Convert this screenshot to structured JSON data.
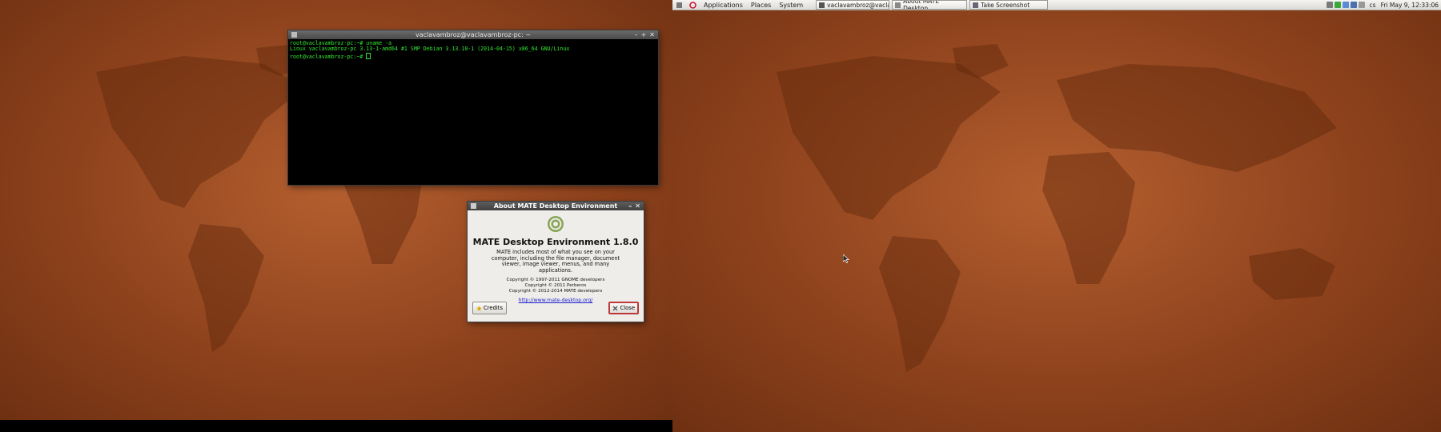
{
  "panel": {
    "menus": [
      "Applications",
      "Places",
      "System"
    ],
    "tasks": [
      {
        "label": "vaclavambroz@vaclav..."
      },
      {
        "label": "About MATE Desktop ..."
      },
      {
        "label": "Take Screenshot"
      }
    ],
    "keyboard_layout": "cs",
    "clock": "Fri May 9, 12:33:06"
  },
  "terminal": {
    "title": "vaclavambroz@vaclavambroz-pc: ~",
    "lines": [
      "root@vaclavambroz-pc:~# uname -a",
      "Linux vaclavambroz-pc 3.13-1-amd64 #1 SMP Debian 3.13.10-1 (2014-04-15) x86_64 GNU/Linux",
      "root@vaclavambroz-pc:~# "
    ]
  },
  "about": {
    "title": "About MATE Desktop Environment",
    "app_name": "MATE Desktop Environment 1.8.0",
    "description": "MATE includes most of what you see on your computer, including the file manager, document viewer, image viewer, menus, and many applications.",
    "copyright": [
      "Copyright © 1997-2011 GNOME developers",
      "Copyright © 2011 Perberos",
      "Copyright © 2012-2014 MATE developers"
    ],
    "website": "http://www.mate-desktop.org/",
    "credits_label": "Credits",
    "close_label": "Close"
  },
  "colors": {
    "terminal_text": "#33e633",
    "wallpaper": "#b4602c",
    "link": "#1a1acc"
  }
}
